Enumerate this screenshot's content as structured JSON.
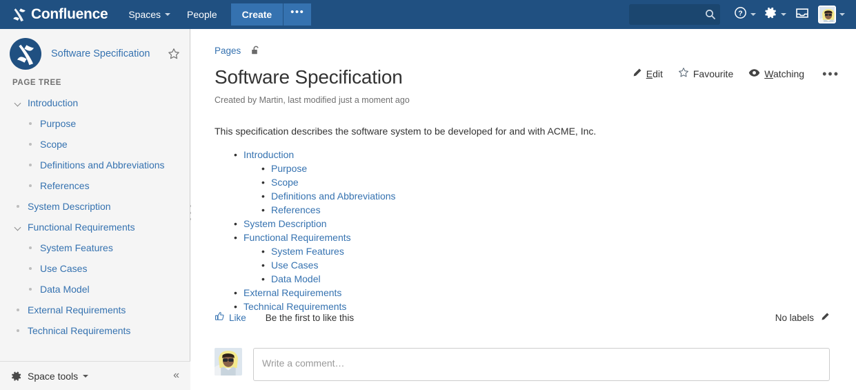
{
  "topnav": {
    "brand": "Confluence",
    "brand_logo_icon": "confluence-logo-icon",
    "items": [
      {
        "label": "Spaces",
        "has_caret": true
      },
      {
        "label": "People",
        "has_caret": false
      }
    ],
    "create_label": "Create",
    "create_more_label": "•••",
    "search": {
      "value": "",
      "placeholder": "",
      "icon": "search-icon"
    },
    "help_icon": "help-circle-icon",
    "settings_icon": "gear-icon",
    "inbox_icon": "inbox-tray-icon",
    "avatar_icon": "user-avatar",
    "background_color": "#205081",
    "create_button_color": "#3572b0"
  },
  "sidebar": {
    "space_name": "Software Specification",
    "space_logo_icon": "confluence-space-logo-icon",
    "star_icon": "star-outline-icon",
    "tree_heading": "PAGE TREE",
    "tree": [
      {
        "label": "Introduction",
        "level": 1,
        "marker": "chevron-down-icon",
        "expanded": true
      },
      {
        "label": "Purpose",
        "level": 2,
        "marker": "bullet-dot"
      },
      {
        "label": "Scope",
        "level": 2,
        "marker": "bullet-dot"
      },
      {
        "label": "Definitions and Abbreviations",
        "level": 2,
        "marker": "bullet-dot"
      },
      {
        "label": "References",
        "level": 2,
        "marker": "bullet-dot"
      },
      {
        "label": "System Description",
        "level": 1,
        "marker": "bullet-dot"
      },
      {
        "label": "Functional Requirements",
        "level": 1,
        "marker": "chevron-down-icon",
        "expanded": true
      },
      {
        "label": "System Features",
        "level": 2,
        "marker": "bullet-dot"
      },
      {
        "label": "Use Cases",
        "level": 2,
        "marker": "bullet-dot"
      },
      {
        "label": "Data Model",
        "level": 2,
        "marker": "bullet-dot"
      },
      {
        "label": "External Requirements",
        "level": 1,
        "marker": "bullet-dot"
      },
      {
        "label": "Technical Requirements",
        "level": 1,
        "marker": "bullet-dot"
      }
    ],
    "space_tools_label": "Space tools",
    "space_tools_icon": "gear-icon",
    "collapse_label": "«",
    "link_color": "#3572b0",
    "background_color": "#f5f5f5"
  },
  "main": {
    "breadcrumb": "Pages",
    "restrictions_icon": "unlocked-padlock-icon",
    "actions": [
      {
        "label": "Edit",
        "accesskey": "E",
        "icon": "pencil-icon"
      },
      {
        "label": "Favourite",
        "accesskey": "",
        "icon": "star-outline-icon"
      },
      {
        "label": "Watching",
        "accesskey": "W",
        "icon": "eye-icon"
      }
    ],
    "more_actions_label": "•••",
    "title": "Software Specification",
    "meta": "Created by Martin, last modified just a moment ago",
    "intro": "This specification describes the software system to be developed for and with ACME, Inc.",
    "toc": [
      {
        "label": "Introduction",
        "level": 1
      },
      {
        "label": "Purpose",
        "level": 2
      },
      {
        "label": "Scope",
        "level": 2
      },
      {
        "label": "Definitions and Abbreviations",
        "level": 2
      },
      {
        "label": "References",
        "level": 2
      },
      {
        "label": "System Description",
        "level": 1
      },
      {
        "label": "Functional Requirements",
        "level": 1
      },
      {
        "label": "System Features",
        "level": 2
      },
      {
        "label": "Use Cases",
        "level": 2
      },
      {
        "label": "Data Model",
        "level": 2
      },
      {
        "label": "External Requirements",
        "level": 1
      },
      {
        "label": "Technical Requirements",
        "level": 1
      }
    ],
    "like": {
      "label": "Like",
      "icon": "thumbs-up-icon",
      "status_text": "Be the first to like this"
    },
    "labels": {
      "text": "No labels",
      "edit_icon": "pencil-icon"
    },
    "comment": {
      "avatar_icon": "user-avatar",
      "placeholder": "Write a comment…",
      "value": ""
    }
  }
}
